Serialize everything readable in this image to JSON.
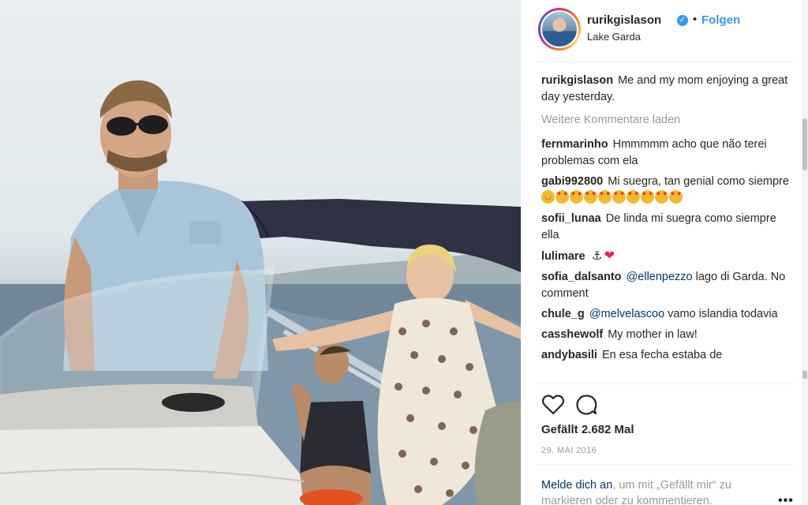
{
  "photo": {
    "alt_subject": "boat-photo"
  },
  "header": {
    "username": "rurikgislason",
    "verified_mark": "✓",
    "separator": "•",
    "follow_label": "Folgen",
    "location": "Lake Garda"
  },
  "caption": {
    "user": "rurikgislason",
    "text": "Me and my mom enjoying a great day yesterday."
  },
  "load_more_label": "Weitere Kommentare laden",
  "comments": [
    {
      "user": "fernmarinho",
      "text": "Hmmmmm acho que não terei problemas com ela"
    },
    {
      "user": "gabi992800",
      "text": "Mi suegra, tan genial como siempre"
    },
    {
      "user": "sofii_lunaa",
      "text": "De linda mi suegra como siempre ella"
    },
    {
      "user": "lulimare",
      "text": ""
    },
    {
      "user": "sofia_dalsanto",
      "mention": "@ellenpezzo",
      "text": "lago di Garda. No comment"
    },
    {
      "user": "chule_g",
      "mention": "@melvelascoo",
      "text": "vamo islandia todavia"
    },
    {
      "user": "casshewolf",
      "text": "My mother in law!"
    },
    {
      "user": "andybasili",
      "text": "En esa fecha estaba de"
    }
  ],
  "actions": {
    "like_icon": "heart-outline-icon",
    "comment_icon": "speech-bubble-icon"
  },
  "likes_text": "Gefällt 2.682 Mal",
  "date_text": "29. MAI 2016",
  "login_prompt": {
    "link": "Melde dich an",
    "text": ", um mit „Gefällt mir“ zu markieren oder zu kommentieren."
  },
  "more_options": "•••",
  "colors": {
    "accent": "#3897f0",
    "link": "#003569",
    "muted": "#999999",
    "text": "#262626"
  }
}
